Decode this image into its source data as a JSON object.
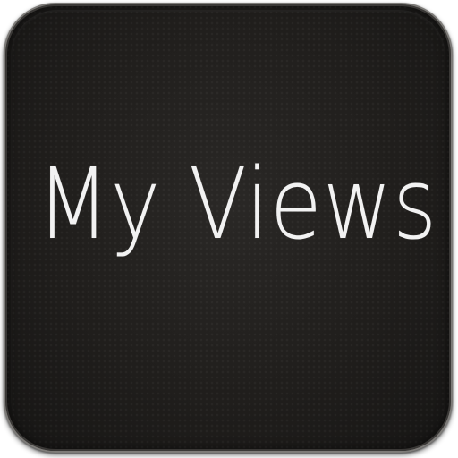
{
  "icon": {
    "label": "My Views",
    "background_color": "#1f1d1b",
    "border_color": "#7d7b78",
    "text_color": "#f2f2f2"
  }
}
